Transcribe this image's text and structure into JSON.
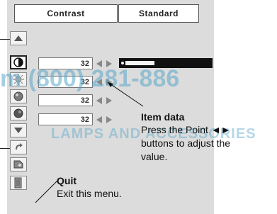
{
  "header": {
    "left_label": "Contrast",
    "right_label": "Standard"
  },
  "rows": [
    {
      "value": "32"
    },
    {
      "value": "32"
    },
    {
      "value": "32"
    },
    {
      "value": "32"
    }
  ],
  "slider": {
    "level": 0.35
  },
  "callouts": {
    "item_data": {
      "title": "Item data",
      "lines": [
        "Press the Point ◄►",
        "buttons to adjust the",
        "value."
      ]
    },
    "quit": {
      "title": "Quit",
      "text": "Exit this menu."
    }
  },
  "watermark": {
    "line1": "m (800) 281-886",
    "line2": "LAMPS AND ACCESSORIES"
  },
  "sidebar_icons": [
    "up-arrow-icon",
    "contrast-icon",
    "brightness-icon",
    "color-icon",
    "tint-icon",
    "down-arrow-icon",
    "reset-icon",
    "store-icon",
    "quit-icon"
  ]
}
